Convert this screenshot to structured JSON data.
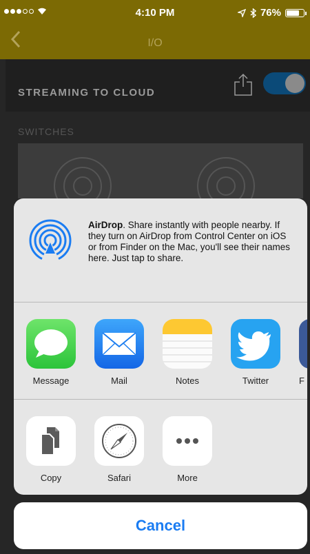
{
  "status_bar": {
    "time": "4:10 PM",
    "battery": "76%",
    "battery_level": 0.76,
    "signal_dots_filled": 3,
    "signal_dots_total": 5
  },
  "nav": {
    "title": "I/O",
    "back_icon": "chevron-left-icon"
  },
  "stream": {
    "label": "STREAMING TO CLOUD",
    "toggle_on": true
  },
  "switches_label": "SWITCHES",
  "share_sheet": {
    "airdrop": {
      "title": "AirDrop",
      "description": ". Share instantly with people nearby. If they turn on AirDrop from Control Center on iOS or from Finder on the Mac, you'll see their names here. Just tap to share."
    },
    "apps": [
      {
        "label": "Message",
        "icon": "messages-icon",
        "color": "#4cd964"
      },
      {
        "label": "Mail",
        "icon": "mail-icon",
        "color": "#1d8cf8"
      },
      {
        "label": "Notes",
        "icon": "notes-icon",
        "color": "#ffcc00"
      },
      {
        "label": "Twitter",
        "icon": "twitter-icon",
        "color": "#1da1f2"
      },
      {
        "label": "F",
        "icon": "facebook-icon",
        "color": "#3b5998"
      }
    ],
    "actions": [
      {
        "label": "Copy",
        "icon": "copy-icon"
      },
      {
        "label": "Safari",
        "icon": "safari-icon"
      },
      {
        "label": "More",
        "icon": "more-icon"
      }
    ]
  },
  "cancel_label": "Cancel",
  "colors": {
    "accent": "#1a7cf2",
    "nav_bar": "#7c6a04",
    "toggle": "#0b4a78"
  }
}
